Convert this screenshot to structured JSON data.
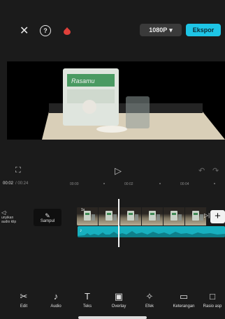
{
  "header": {
    "close_icon": "✕",
    "help_icon": "?",
    "resolution_label": "1080P",
    "resolution_caret": "▾",
    "export_label": "Ekspor"
  },
  "preview": {
    "scene": "product photo: bag labeled Rasamu with glass and rice on table",
    "bag_label": "Rasamu"
  },
  "controls": {
    "fullscreen_icon": "⛶",
    "play_icon": "▷",
    "undo_icon": "↶",
    "redo_icon": "↷"
  },
  "timeline": {
    "current_time": "00:02",
    "total_time": "/ 00:24",
    "ticks": [
      "00:00",
      "00:02",
      "00:04"
    ],
    "left_tool_label": "unyikan\naudio klip",
    "cover_label": "Sampul",
    "speed_badge": "1x",
    "audio_icon": "♪"
  },
  "bottom_tools": [
    {
      "label": "Edit",
      "icon": "✂"
    },
    {
      "label": "Audio",
      "icon": "♪"
    },
    {
      "label": "Teks",
      "icon": "T"
    },
    {
      "label": "Overlay",
      "icon": "▣"
    },
    {
      "label": "Efek",
      "icon": "✧"
    },
    {
      "label": "Keterangan",
      "icon": "▭"
    },
    {
      "label": "Rasio asp",
      "icon": "□"
    }
  ],
  "colors": {
    "accent": "#1ec5e6",
    "audio_track": "#17b0bf",
    "record_dot": "#e0403a"
  }
}
